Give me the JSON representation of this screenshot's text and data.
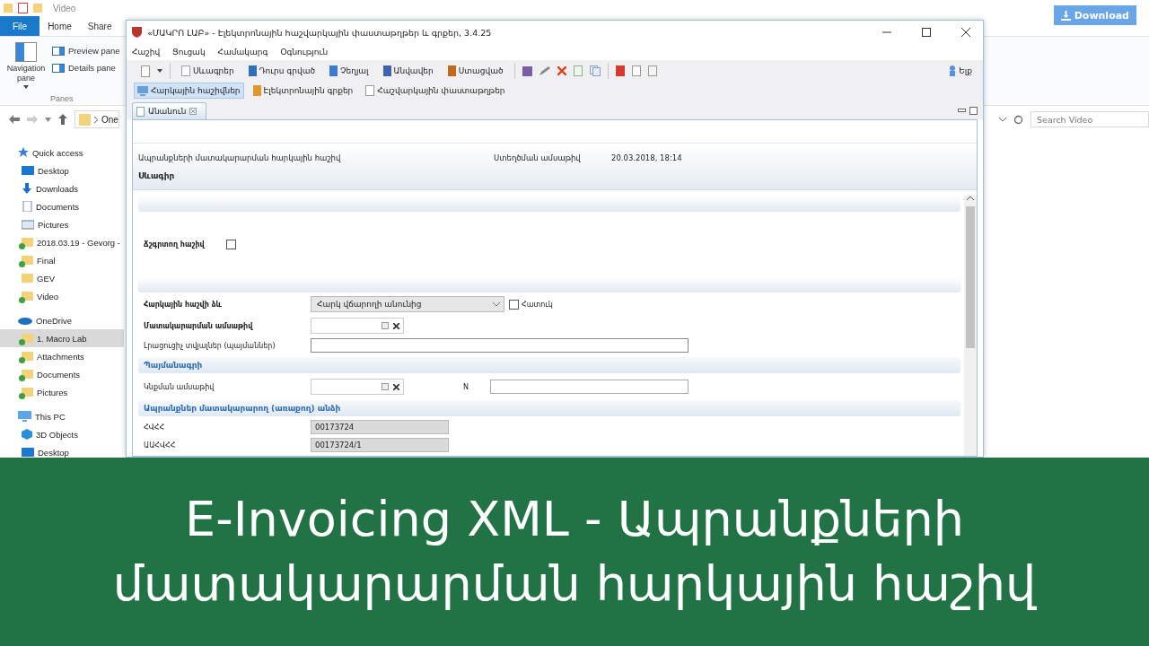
{
  "explorer": {
    "title": "Video",
    "ribbon_tabs": [
      {
        "label": "File",
        "selected": true
      },
      {
        "label": "Home",
        "selected": false
      },
      {
        "label": "Share",
        "selected": false
      }
    ],
    "ribbon": {
      "navigation_pane": "Navigation pane",
      "preview_pane": "Preview pane",
      "details_pane": "Details pane",
      "group_label": "Panes"
    },
    "address": "One",
    "download_button": "Download",
    "search": {
      "placeholder": "Search Video"
    },
    "nav_tree": [
      {
        "label": "Quick access",
        "kind": "star",
        "selected": false,
        "children": [
          {
            "label": "Desktop",
            "kind": "desktop",
            "selected": false,
            "synced": false
          },
          {
            "label": "Downloads",
            "kind": "download",
            "selected": false,
            "synced": false
          },
          {
            "label": "Documents",
            "kind": "document",
            "selected": false,
            "synced": false
          },
          {
            "label": "Pictures",
            "kind": "pictures",
            "selected": false,
            "synced": false
          },
          {
            "label": "2018.03.19 - Gevorg -",
            "kind": "folder",
            "selected": false,
            "synced": true
          },
          {
            "label": "Final",
            "kind": "folder",
            "selected": false,
            "synced": true
          },
          {
            "label": "GEV",
            "kind": "folder",
            "selected": false,
            "synced": false
          },
          {
            "label": "Video",
            "kind": "folder",
            "selected": false,
            "synced": true
          }
        ]
      },
      {
        "label": "OneDrive",
        "kind": "cloud",
        "selected": false,
        "children": [
          {
            "label": "1. Macro Lab",
            "kind": "folder",
            "selected": true,
            "synced": true
          },
          {
            "label": "Attachments",
            "kind": "folder",
            "selected": false,
            "synced": true
          },
          {
            "label": "Documents",
            "kind": "folder",
            "selected": false,
            "synced": true
          },
          {
            "label": "Pictures",
            "kind": "folder",
            "selected": false,
            "synced": true
          }
        ]
      },
      {
        "label": "This PC",
        "kind": "pc",
        "selected": false,
        "children": [
          {
            "label": "3D Objects",
            "kind": "objects3d",
            "selected": false,
            "synced": false
          },
          {
            "label": "Desktop",
            "kind": "desktop",
            "selected": false,
            "synced": false
          }
        ]
      }
    ]
  },
  "app": {
    "title": "«ՄԱԿՐՈ ԼԱԲ» - Էլեկտրոնային հաշվարկային փաստաթղթեր և գրքեր, 3.4.25",
    "menu": [
      "Հաշիվ",
      "Ցուցակ",
      "Համակարգ",
      "Օգնություն"
    ],
    "toolbar": [
      {
        "label": "Սևագրեր",
        "kind": "doc",
        "color": "#9aa4b0"
      },
      {
        "label": "Դուրս գրված",
        "kind": "book",
        "color": "#2f6fc0"
      },
      {
        "label": "Չեղյալ",
        "kind": "book",
        "color": "#3a7ad0"
      },
      {
        "label": "Անվավեր",
        "kind": "book",
        "color": "#4060b0"
      },
      {
        "label": "Ստացված",
        "kind": "book",
        "color": "#c06a20"
      }
    ],
    "exit_button": "Ելք",
    "modules": [
      {
        "label": "Հարկային հաշիվներ",
        "kind": "monitor",
        "selected": true
      },
      {
        "label": "Էլեկտրոնային գրքեր",
        "kind": "book",
        "selected": false
      },
      {
        "label": "Հաշվարկային փաստաթղթեր",
        "kind": "doc",
        "selected": false
      }
    ],
    "doc_tab": "Անանուն",
    "form": {
      "doc_type": "Ապրանքների մատակարարման հարկային հաշիվ",
      "created_label": "Ստեղծման ամսաթիվ",
      "created_value": "20.03.2018, 18:14",
      "status": "Սևագիր",
      "correction": {
        "label": "Ճշգրտող հաշիվ",
        "checked": false
      },
      "invoice_form": {
        "label": "Հարկային հաշվի ձև",
        "value": "Հարկ վճարողի անունից",
        "special": {
          "label": "Հատուկ",
          "checked": false
        }
      },
      "delivery_date": {
        "label": "Մատակարարման ամսաթիվ"
      },
      "additional": {
        "label": "Լրացուցիչ տվյալներ (պայմաններ)"
      },
      "contract": {
        "heading": "Պայմանագրի",
        "date_label": "Կնքման ամսաթիվ",
        "number_label": "N"
      },
      "supplier": {
        "heading": "Ապրանքներ մատակարարող (առաքող) անձի",
        "rows": [
          {
            "label": "ՀՎՀՀ",
            "value": "00173724"
          },
          {
            "label": "ԱԱՀՎՀՀ",
            "value": "00173724/1"
          }
        ]
      }
    }
  },
  "banner": [
    "E-Invoicing XML - Ապրանքների",
    "մատակարարման հարկային հաշիվ"
  ]
}
